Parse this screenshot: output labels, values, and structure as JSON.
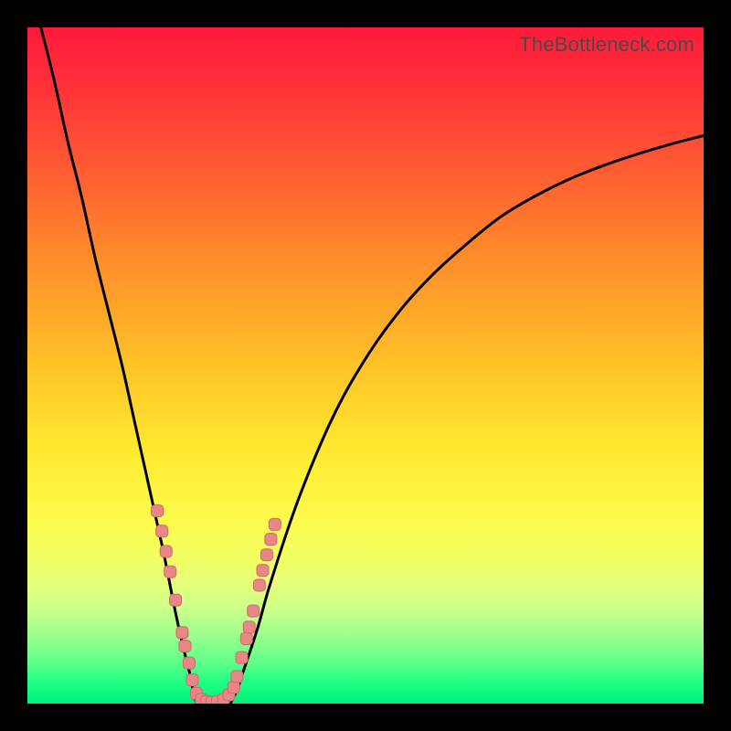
{
  "watermark": "TheBottleneck.com",
  "colors": {
    "frame": "#000000",
    "curve": "#000000",
    "marker_fill": "#e98686",
    "marker_stroke": "#cf6a6a"
  },
  "chart_data": {
    "type": "line",
    "title": "",
    "xlabel": "",
    "ylabel": "",
    "xlim": [
      0,
      100
    ],
    "ylim": [
      0,
      100
    ],
    "grid": false,
    "legend": false,
    "annotations": [
      "TheBottleneck.com"
    ],
    "note": "Values are percentages of plot width/height read from pixel positions; y=0 is the bottom (green) edge, y=100 is the top (red) edge.",
    "series": [
      {
        "name": "left-branch",
        "x": [
          2,
          4,
          6,
          8,
          10,
          12,
          14,
          16,
          18,
          20,
          21,
          22,
          23,
          24,
          24.5,
          25
        ],
        "y": [
          100,
          92,
          83,
          75,
          66,
          58,
          50,
          41,
          32,
          23,
          18,
          13,
          8.5,
          4.5,
          2,
          0
        ]
      },
      {
        "name": "valley-floor",
        "x": [
          25,
          26,
          27,
          28,
          29,
          30
        ],
        "y": [
          0,
          0,
          0,
          0,
          0,
          0
        ]
      },
      {
        "name": "right-branch",
        "x": [
          30,
          31,
          32,
          34,
          36,
          40,
          45,
          50,
          55,
          60,
          65,
          70,
          75,
          80,
          85,
          90,
          95,
          100
        ],
        "y": [
          0,
          2,
          5,
          11,
          18,
          30,
          42,
          51,
          58,
          63.5,
          68,
          72,
          75,
          77.5,
          79.5,
          81.2,
          82.7,
          84
        ]
      }
    ],
    "markers": {
      "name": "highlighted-points",
      "shape": "rounded-rect",
      "color": "#e98686",
      "points_xy": [
        [
          19.2,
          28.5
        ],
        [
          19.9,
          25.5
        ],
        [
          20.5,
          22.5
        ],
        [
          21.1,
          19.5
        ],
        [
          21.9,
          15.3
        ],
        [
          22.9,
          10.5
        ],
        [
          23.3,
          8.5
        ],
        [
          23.9,
          6.0
        ],
        [
          24.4,
          3.5
        ],
        [
          25.0,
          1.5
        ],
        [
          25.7,
          0.6
        ],
        [
          26.5,
          0.3
        ],
        [
          27.3,
          0.2
        ],
        [
          28.1,
          0.3
        ],
        [
          29.0,
          0.6
        ],
        [
          29.8,
          1.3
        ],
        [
          30.5,
          2.4
        ],
        [
          31.0,
          4.0
        ],
        [
          31.7,
          6.8
        ],
        [
          32.4,
          9.6
        ],
        [
          32.8,
          11.3
        ],
        [
          33.4,
          13.7
        ],
        [
          34.3,
          17.5
        ],
        [
          34.8,
          19.7
        ],
        [
          35.4,
          22.0
        ],
        [
          36.0,
          24.3
        ],
        [
          36.6,
          26.5
        ]
      ]
    }
  }
}
